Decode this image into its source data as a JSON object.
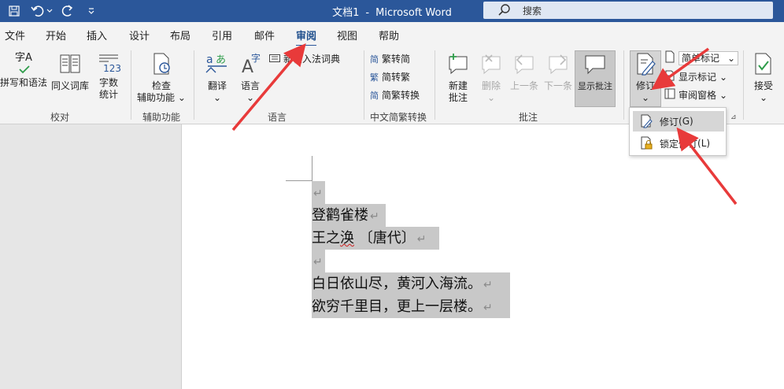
{
  "titlebar": {
    "doc_name": "文档1",
    "separator": "-",
    "app_name": "Microsoft Word",
    "search_placeholder": "搜索"
  },
  "tabs": [
    "文件",
    "开始",
    "插入",
    "设计",
    "布局",
    "引用",
    "邮件",
    "审阅",
    "视图",
    "帮助"
  ],
  "active_tab": "审阅",
  "ribbon": {
    "proofing": {
      "spelling": "拼写和语法",
      "thesaurus": "同义词库",
      "wordcount_1": "字数",
      "wordcount_2": "统计",
      "label": "校对",
      "icon_text_zi": "字A",
      "icon_text_123": "123"
    },
    "accessibility": {
      "check_1": "检查",
      "check_2": "辅助功能",
      "label": "辅助功能"
    },
    "language": {
      "translate": "翻译",
      "language": "语言",
      "ime_dict": "新输入法词典",
      "label": "语言"
    },
    "chinese": {
      "trad_to_simp": "繁转简",
      "simp_to_trad": "简转繁",
      "convert": "简繁转换",
      "label": "中文简繁转换"
    },
    "comments": {
      "new_1": "新建",
      "new_2": "批注",
      "delete": "删除",
      "prev": "上一条",
      "next": "下一条",
      "show": "显示批注",
      "label": "批注"
    },
    "tracking": {
      "track": "修订",
      "markup_select": "简单标记",
      "show_markup": "显示标记",
      "review_pane": "审阅窗格"
    },
    "accept": {
      "label": "接受"
    }
  },
  "dropdown": {
    "track_changes": {
      "text": "修订",
      "key": "(G)"
    },
    "lock_tracking": {
      "text": "锁定修订",
      "key": "(L)"
    }
  },
  "document": {
    "lines": [
      "",
      "登鹳雀楼",
      "王之涣 〔唐代〕",
      "",
      "白日依山尽，黄河入海流。",
      "欲穷千里目，更上一层楼。"
    ],
    "author_plain": "王之",
    "author_marked": "涣",
    "author_era": " 〔唐代〕",
    "para_mark": "↵"
  },
  "colors": {
    "titlebar": "#2b579a",
    "highlight": "#c8c8c8",
    "arrow": "#e83a3a"
  }
}
